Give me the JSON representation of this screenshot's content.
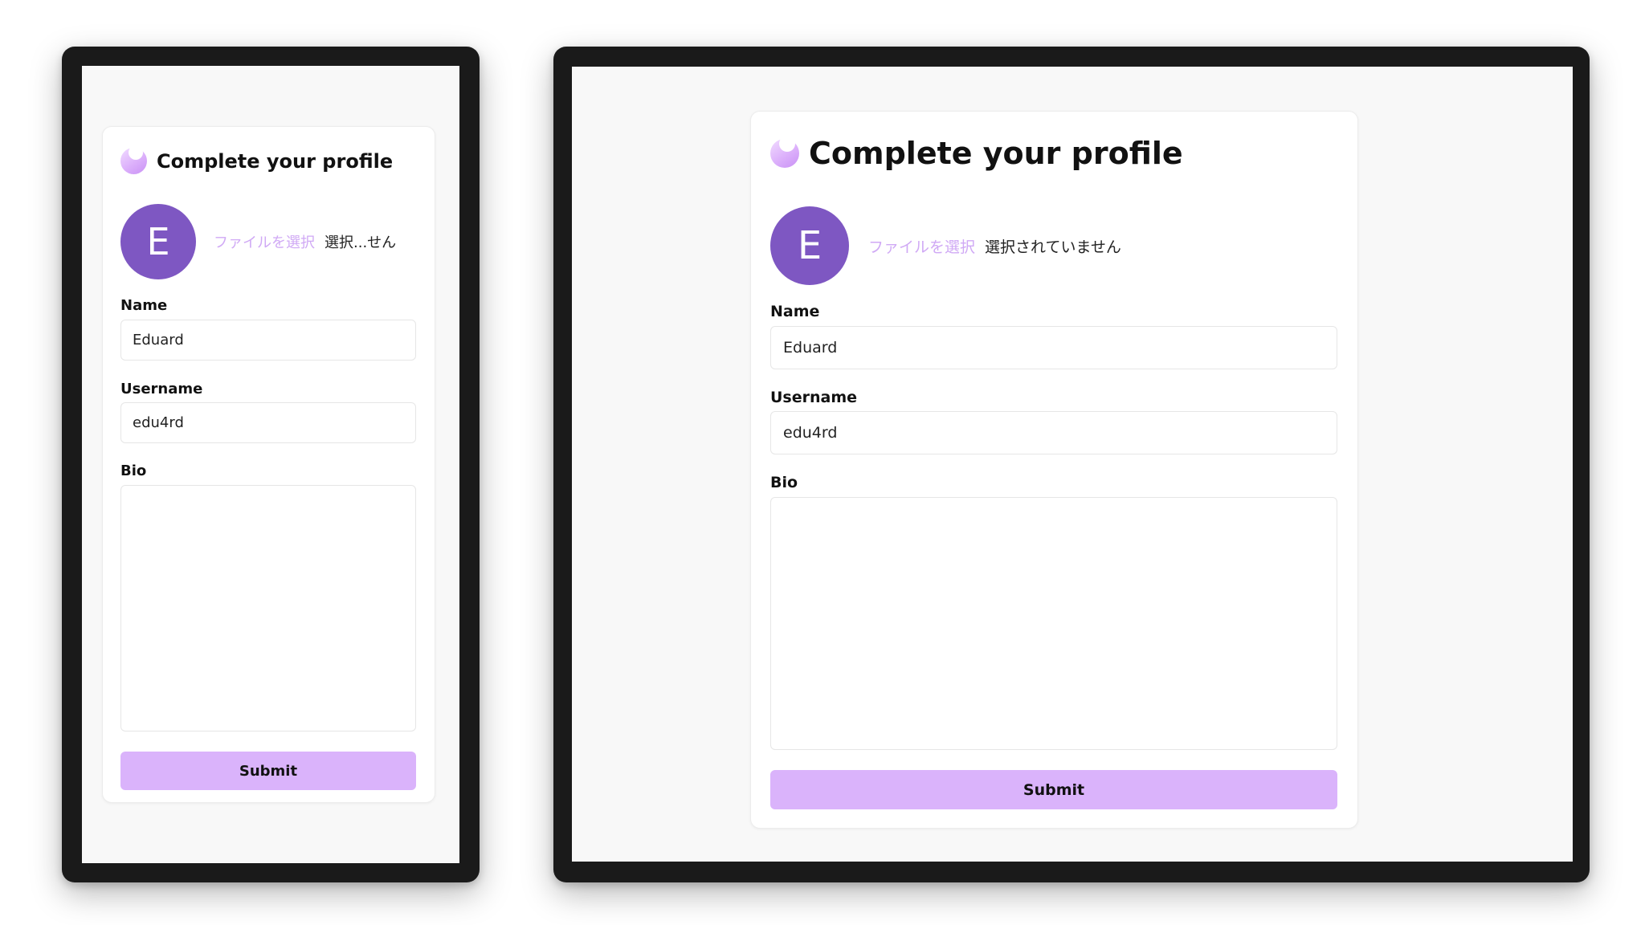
{
  "mobile": {
    "title": "Complete your profile",
    "avatar_initial": "E",
    "file_button": "ファイルを選択",
    "file_status": "選択...せん",
    "name_label": "Name",
    "name_value": "Eduard",
    "username_label": "Username",
    "username_value": "edu4rd",
    "bio_label": "Bio",
    "bio_value": "",
    "submit_label": "Submit"
  },
  "desktop": {
    "title": "Complete your profile",
    "avatar_initial": "E",
    "file_button": "ファイルを選択",
    "file_status": "選択されていません",
    "name_label": "Name",
    "name_value": "Eduard",
    "username_label": "Username",
    "username_value": "edu4rd",
    "bio_label": "Bio",
    "bio_value": "",
    "submit_label": "Submit"
  },
  "colors": {
    "accent": "#dab3fb",
    "avatar_bg": "#7e57c2",
    "file_button_text": "#d0a9f5",
    "device_frame": "#1a1a1a",
    "page_bg": "#f8f8f8"
  },
  "icons": {
    "logo": "crescent-logo-icon"
  }
}
